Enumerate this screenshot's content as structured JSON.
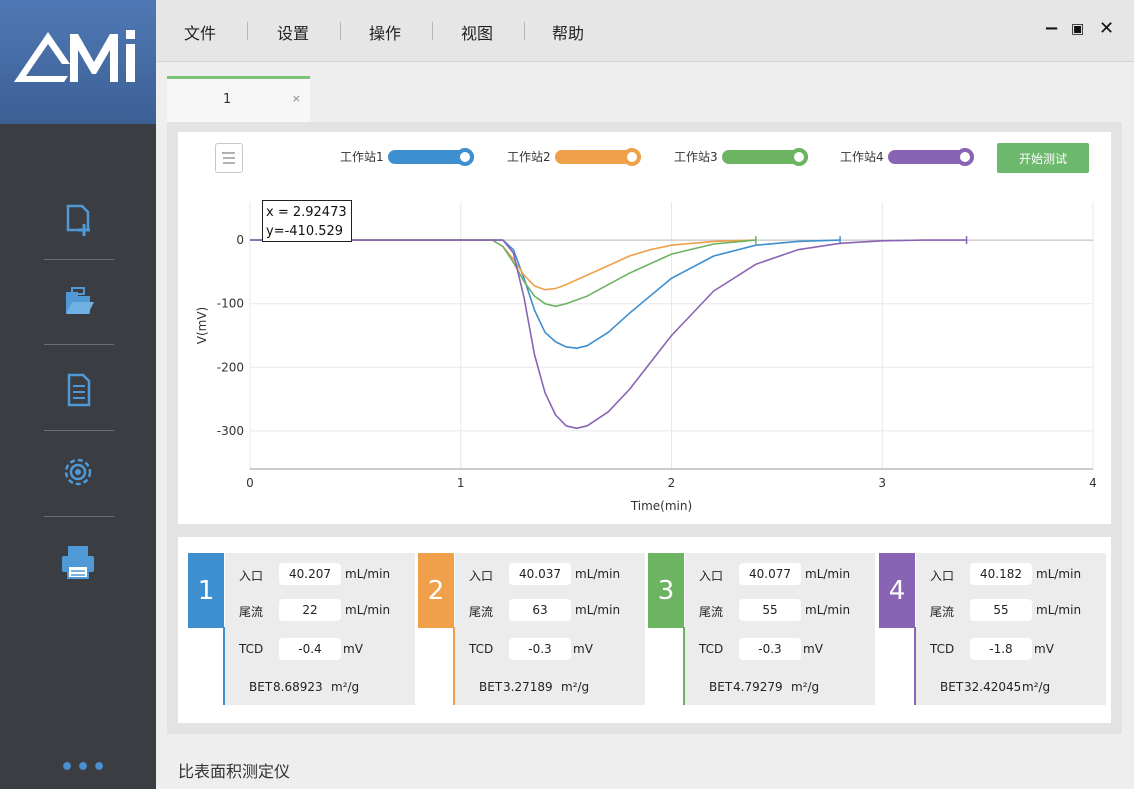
{
  "sidebar": {
    "logo_text": "AMI",
    "icons": [
      {
        "name": "new-file-icon"
      },
      {
        "name": "open-folder-icon"
      },
      {
        "name": "report-icon"
      },
      {
        "name": "settings-icon"
      },
      {
        "name": "printer-icon"
      }
    ],
    "more": "•••"
  },
  "menu": {
    "items": [
      "文件",
      "设置",
      "操作",
      "视图",
      "帮助"
    ],
    "window_controls": {
      "minimize": "−",
      "maximize": "▣",
      "close": "✕"
    }
  },
  "tabs": [
    {
      "label": "1",
      "close": "×"
    }
  ],
  "legend": [
    {
      "label": "工作站1",
      "color": "#3e8fcf"
    },
    {
      "label": "工作站2",
      "color": "#f0a04a"
    },
    {
      "label": "工作站3",
      "color": "#6cb462"
    },
    {
      "label": "工作站4",
      "color": "#8a64b4"
    }
  ],
  "start_button": "开始测试",
  "tooltip": {
    "x_text": "x = 2.92473",
    "y_text": "y=-410.529"
  },
  "chart_data": {
    "type": "line",
    "xlabel": "Time(min)",
    "ylabel": "V(mV)",
    "xlim": [
      0,
      4
    ],
    "ylim": [
      -360,
      60
    ],
    "xticks": [
      0,
      1,
      2,
      3,
      4
    ],
    "yticks": [
      0,
      -100,
      -200,
      -300
    ],
    "grid": true,
    "series": [
      {
        "name": "工作站1",
        "color": "#3e8fcf",
        "x": [
          0,
          0.5,
          1.0,
          1.2,
          1.25,
          1.3,
          1.35,
          1.4,
          1.45,
          1.5,
          1.55,
          1.6,
          1.7,
          1.8,
          2.0,
          2.2,
          2.4,
          2.6,
          2.8
        ],
        "y": [
          0,
          0,
          0,
          0,
          -15,
          -60,
          -110,
          -145,
          -160,
          -168,
          -170,
          -166,
          -145,
          -115,
          -60,
          -25,
          -8,
          -2,
          0
        ]
      },
      {
        "name": "工作站2",
        "color": "#f0a04a",
        "x": [
          0,
          0.5,
          1.0,
          1.15,
          1.2,
          1.25,
          1.3,
          1.35,
          1.4,
          1.45,
          1.5,
          1.6,
          1.7,
          1.8,
          1.9,
          2.0,
          2.2,
          2.4
        ],
        "y": [
          0,
          0,
          0,
          0,
          -10,
          -30,
          -55,
          -72,
          -78,
          -76,
          -70,
          -55,
          -40,
          -25,
          -15,
          -8,
          -2,
          0
        ]
      },
      {
        "name": "工作站3",
        "color": "#6cb462",
        "x": [
          0,
          0.5,
          1.0,
          1.15,
          1.2,
          1.25,
          1.3,
          1.35,
          1.4,
          1.45,
          1.5,
          1.6,
          1.7,
          1.8,
          2.0,
          2.2,
          2.4
        ],
        "y": [
          0,
          0,
          0,
          0,
          -10,
          -35,
          -65,
          -88,
          -100,
          -104,
          -100,
          -88,
          -70,
          -52,
          -22,
          -6,
          0
        ]
      },
      {
        "name": "工作站4",
        "color": "#8a64b4",
        "x": [
          0,
          0.5,
          1.0,
          1.2,
          1.25,
          1.3,
          1.35,
          1.4,
          1.45,
          1.5,
          1.55,
          1.6,
          1.7,
          1.8,
          2.0,
          2.2,
          2.4,
          2.6,
          2.8,
          3.0,
          3.2,
          3.4
        ],
        "y": [
          0,
          0,
          0,
          0,
          -20,
          -90,
          -180,
          -240,
          -275,
          -292,
          -296,
          -292,
          -270,
          -235,
          -150,
          -80,
          -38,
          -15,
          -5,
          -1,
          0,
          0
        ]
      }
    ]
  },
  "stations": [
    {
      "num": "1",
      "color": "#3e8fcf",
      "inlet_label": "入口",
      "inlet": "40.207",
      "inlet_unit": "mL/min",
      "tail_label": "尾流",
      "tail": "22",
      "tail_unit": "mL/min",
      "tcd_label": "TCD",
      "tcd": "-0.4",
      "tcd_unit": "mV",
      "bet_label": "BET",
      "bet": "8.68923",
      "bet_unit": "m²/g"
    },
    {
      "num": "2",
      "color": "#f0a04a",
      "inlet_label": "入口",
      "inlet": "40.037",
      "inlet_unit": "mL/min",
      "tail_label": "尾流",
      "tail": "63",
      "tail_unit": "mL/min",
      "tcd_label": "TCD",
      "tcd": "-0.3",
      "tcd_unit": "mV",
      "bet_label": "BET",
      "bet": "3.27189",
      "bet_unit": "m²/g"
    },
    {
      "num": "3",
      "color": "#6cb462",
      "inlet_label": "入口",
      "inlet": "40.077",
      "inlet_unit": "mL/min",
      "tail_label": "尾流",
      "tail": "55",
      "tail_unit": "mL/min",
      "tcd_label": "TCD",
      "tcd": "-0.3",
      "tcd_unit": "mV",
      "bet_label": "BET",
      "bet": "4.79279",
      "bet_unit": "m²/g"
    },
    {
      "num": "4",
      "color": "#8a64b4",
      "inlet_label": "入口",
      "inlet": "40.182",
      "inlet_unit": "mL/min",
      "tail_label": "尾流",
      "tail": "55",
      "tail_unit": "mL/min",
      "tcd_label": "TCD",
      "tcd": "-1.8",
      "tcd_unit": "mV",
      "bet_label": "BET",
      "bet": "32.42045",
      "bet_unit": "m²/g"
    }
  ],
  "footer": "比表面积测定仪"
}
